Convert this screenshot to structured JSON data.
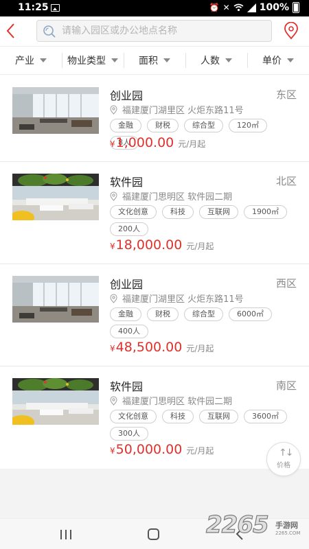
{
  "status_bar": {
    "time": "11:25",
    "battery": "100%",
    "icons": [
      "gallery-icon",
      "alarm-icon",
      "mute-icon",
      "wifi-icon",
      "signal-icon",
      "battery-icon"
    ]
  },
  "header": {
    "search_placeholder": "请输入园区或办公地点名称",
    "icons": [
      "back-arrow-icon",
      "search-icon",
      "location-pin-icon"
    ],
    "accent_color": "#e0302b"
  },
  "filters": [
    {
      "label": "产业"
    },
    {
      "label": "物业类型"
    },
    {
      "label": "面积"
    },
    {
      "label": "人数"
    },
    {
      "label": "单价"
    }
  ],
  "listings": [
    {
      "title": "创业园",
      "district": "东区",
      "address": "福建厦门湖里区 火炬东路11号",
      "tags": [
        "金融",
        "财税",
        "综合型",
        "120㎡",
        "8人"
      ],
      "currency": "¥",
      "price": "1,000.00",
      "unit": "元/月起"
    },
    {
      "title": "软件园",
      "district": "北区",
      "address": "福建厦门思明区 软件园二期",
      "tags": [
        "文化创意",
        "科技",
        "互联网",
        "1900㎡",
        "200人"
      ],
      "currency": "¥",
      "price": "18,000.00",
      "unit": "元/月起"
    },
    {
      "title": "创业园",
      "district": "西区",
      "address": "福建厦门湖里区 火炬东路11号",
      "tags": [
        "金融",
        "财税",
        "综合型",
        "6000㎡",
        "400人"
      ],
      "currency": "¥",
      "price": "48,500.00",
      "unit": "元/月起"
    },
    {
      "title": "软件园",
      "district": "南区",
      "address": "福建厦门思明区 软件园二期",
      "tags": [
        "文化创意",
        "科技",
        "互联网",
        "3600㎡",
        "300人"
      ],
      "currency": "¥",
      "price": "50,000.00",
      "unit": "元/月起"
    }
  ],
  "sort_button": {
    "label": "价格",
    "icon": "sort-arrows-icon"
  },
  "nav_bar": {
    "icons": [
      "recent-apps-icon",
      "home-icon",
      "back-icon"
    ]
  },
  "watermark": {
    "number": "2265",
    "text": "手游网",
    "url": "2265.COM"
  }
}
